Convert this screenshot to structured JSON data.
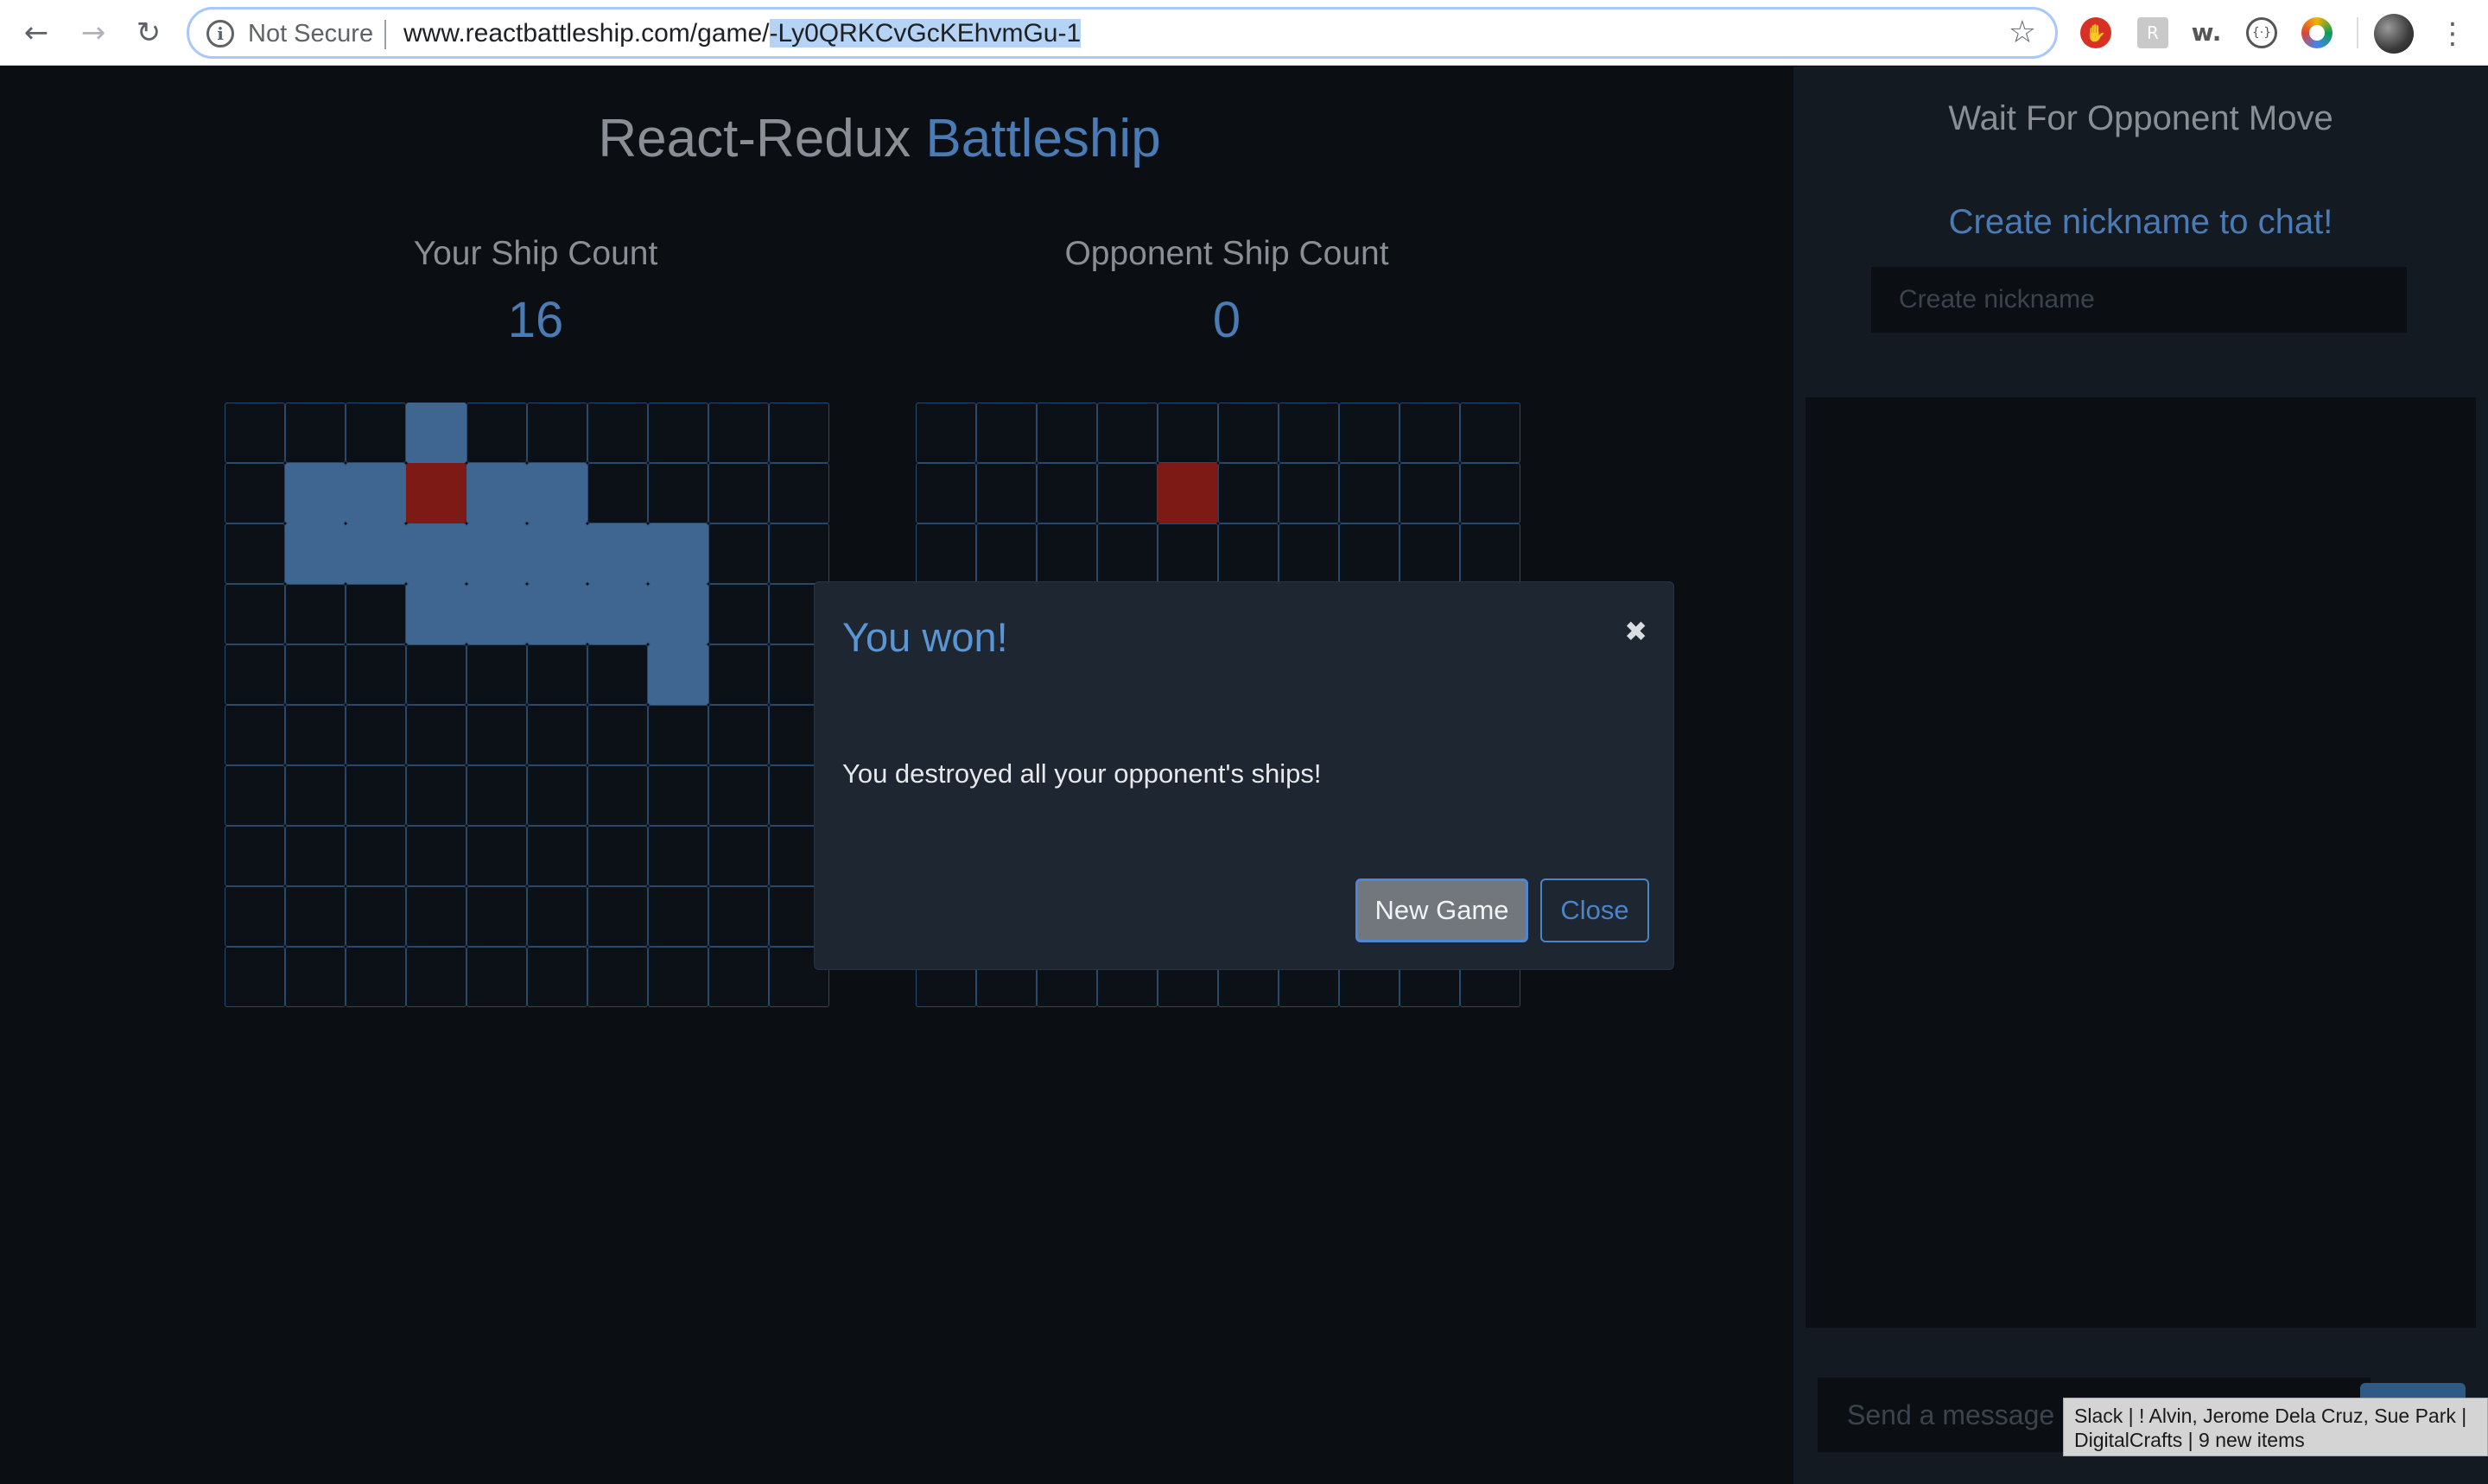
{
  "browser": {
    "security_label": "Not Secure",
    "url_prefix": "www.reactbattleship.com/game/",
    "url_selected": "-Ly0QRKCvGcKEhvmGu-1",
    "icons": [
      "back-arrow-icon",
      "forward-arrow-icon",
      "reload-icon",
      "info-icon",
      "star-icon",
      "menu-dots-icon"
    ]
  },
  "game": {
    "title_part1": "React-Redux ",
    "title_part2": "Battleship",
    "your_count_label": "Your Ship Count",
    "your_count_value": "16",
    "opponent_count_label": "Opponent Ship Count",
    "opponent_count_value": "0",
    "your_board": {
      "size": 10,
      "ships": [
        [
          1,
          1
        ],
        [
          1,
          2
        ],
        [
          2,
          1
        ],
        [
          2,
          2
        ],
        [
          3,
          0
        ],
        [
          3,
          1
        ],
        [
          3,
          2
        ],
        [
          3,
          3
        ],
        [
          4,
          1
        ],
        [
          4,
          2
        ],
        [
          4,
          3
        ],
        [
          5,
          1
        ],
        [
          5,
          2
        ],
        [
          5,
          3
        ],
        [
          6,
          2
        ],
        [
          6,
          3
        ],
        [
          7,
          2
        ],
        [
          7,
          3
        ],
        [
          7,
          4
        ]
      ],
      "hits": [
        [
          3,
          1
        ]
      ]
    },
    "opponent_board": {
      "size": 10,
      "ships": [],
      "hits": [
        [
          4,
          1
        ]
      ]
    },
    "colors": {
      "ship": "#3e6690",
      "hit": "#7d1a16",
      "accent": "#4a7bb5"
    }
  },
  "sidebar": {
    "status": "Wait For Opponent Move",
    "chat_prompt": "Create nickname to chat!",
    "nickname_placeholder": "Create nickname",
    "message_placeholder": "Send a message"
  },
  "modal": {
    "title": "You won!",
    "close_symbol": "✖",
    "body": "You destroyed all your opponent's ships!",
    "new_game_label": "New Game",
    "close_label": "Close"
  },
  "notification": {
    "line1": "Slack | ! Alvin, Jerome Dela Cruz, Sue Park |",
    "line2": "DigitalCrafts | 9 new items"
  }
}
